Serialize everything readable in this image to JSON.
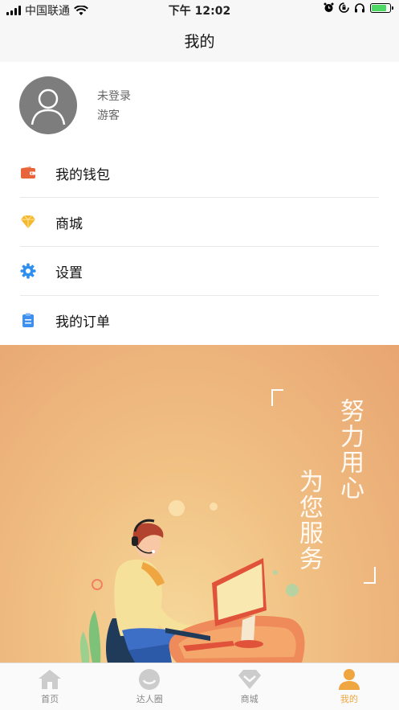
{
  "status_bar": {
    "carrier": "中国联通",
    "time": "下午 12:02",
    "icons": [
      "signal-icon",
      "wifi-icon",
      "alarm-icon",
      "rotation-lock-icon",
      "headphones-icon",
      "battery-icon"
    ]
  },
  "nav": {
    "title": "我的"
  },
  "profile": {
    "status": "未登录",
    "name": "游客"
  },
  "menu": {
    "items": [
      {
        "label": "我的钱包",
        "icon": "wallet-icon",
        "color": "#e8643a"
      },
      {
        "label": "商城",
        "icon": "diamond-icon",
        "color": "#f5b82e"
      },
      {
        "label": "设置",
        "icon": "gear-icon",
        "color": "#2f8ff0"
      },
      {
        "label": "我的订单",
        "icon": "clipboard-icon",
        "color": "#3d8ff0"
      }
    ]
  },
  "banner": {
    "slogan_line1": "努力用心",
    "slogan_line2": "为您服务"
  },
  "tabbar": {
    "tabs": [
      {
        "label": "首页",
        "icon": "home-icon"
      },
      {
        "label": "达人圈",
        "icon": "smile-icon"
      },
      {
        "label": "商城",
        "icon": "shop-icon"
      },
      {
        "label": "我的",
        "icon": "user-icon",
        "active": true
      }
    ]
  },
  "colors": {
    "accent": "#f0a640",
    "tab_inactive": "#cccccc",
    "banner_bg": "#eeb47c"
  }
}
